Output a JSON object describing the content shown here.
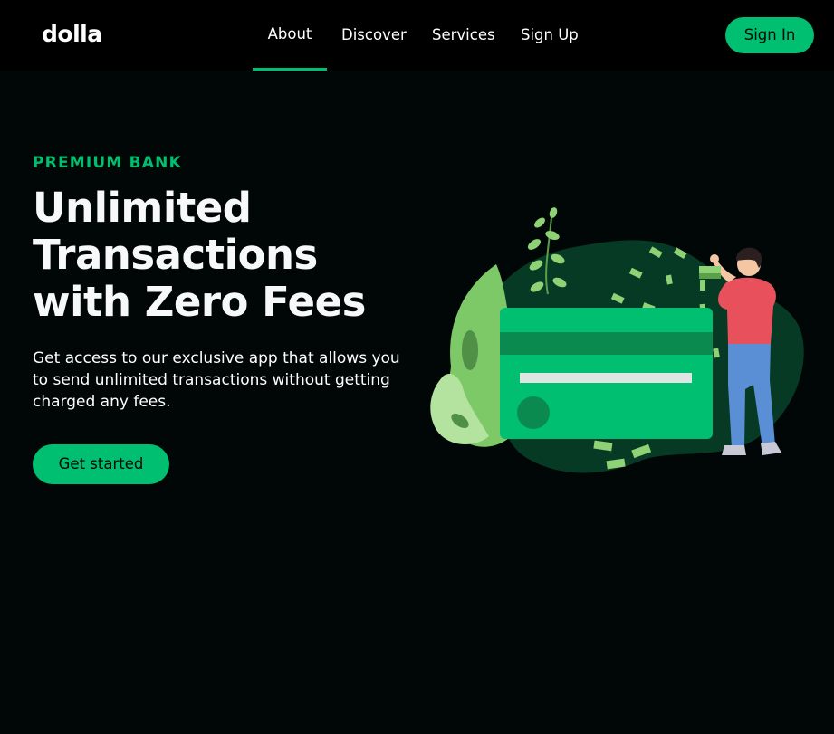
{
  "navbar": {
    "logo": "dolla",
    "links": [
      {
        "label": "About",
        "active": true
      },
      {
        "label": "Discover",
        "active": false
      },
      {
        "label": "Services",
        "active": false
      },
      {
        "label": "Sign Up",
        "active": false
      }
    ],
    "signin_label": "Sign In"
  },
  "hero": {
    "eyebrow": "PREMIUM BANK",
    "headline": "Unlimited Transactions with Zero Fees",
    "subtitle": "Get access to our exclusive app that allows you to send unlimited transactions without getting charged any fees.",
    "cta_label": "Get started",
    "illustration_icon": "credit-card-money-illustration"
  },
  "colors": {
    "background": "#010606",
    "navbar": "#000000",
    "accent": "#01bf71",
    "text": "#ffffff"
  }
}
